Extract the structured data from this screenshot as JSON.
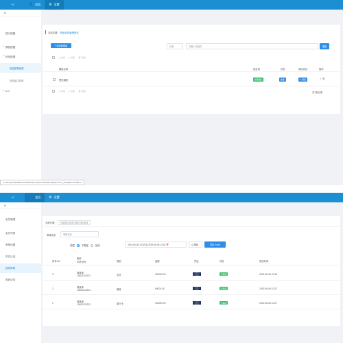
{
  "shot1": {
    "topbar": {
      "logo": "·H",
      "nav": [
        {
          "icon": "user-icon",
          "label": "会员"
        },
        {
          "icon": "gear-icon",
          "label": "设置"
        }
      ]
    },
    "sidebar": {
      "head": "Ω",
      "items": [
        {
          "label": "提示配置"
        },
        {
          "label": "模板配置"
        },
        {
          "label": "短信配置"
        },
        {
          "label": "短信配置管理",
          "sub": true,
          "active": true
        },
        {
          "label": "短信接口配置",
          "sub": true
        },
        {
          "label": "A.O",
          "partial": true
        }
      ]
    },
    "breadcrumb": {
      "label": "当前位置:",
      "link": "短信消息管理首页"
    },
    "toolbar": {
      "add_label": "+ 添加新模板",
      "search_select": "状态",
      "search_placeholder": "请输入关键词",
      "search_btn": "搜索"
    },
    "bulk": [
      "启用",
      "禁用",
      "删除"
    ],
    "table": {
      "headers": [
        "模板名称",
        "是否用",
        "状态",
        "调试测试",
        "操作"
      ],
      "rows": [
        {
          "name": "短信通知",
          "use_tag": "启用短信",
          "status_tag": "启用",
          "action": "✎ 测试"
        }
      ]
    },
    "footer": {
      "total": "共1条记录"
    },
    "url": "u.m114.yunyan008.com/web/index.php?c=site&a=entry&m=xxx_shop&do=web&r=s"
  },
  "shot2": {
    "topbar": {
      "logo": "·H",
      "nav": [
        {
          "icon": "user-icon",
          "label": "会员"
        },
        {
          "icon": "gear-icon",
          "label": "设置"
        }
      ]
    },
    "sidebar": {
      "head": "Ω",
      "items": [
        {
          "label": "会员管理"
        },
        {
          "label": "会员列表"
        },
        {
          "label": "审核设置"
        },
        {
          "label": "实名认证"
        },
        {
          "label": "提现审核",
          "active": true
        },
        {
          "label": "收款记录"
        }
      ]
    },
    "breadcrumb": {
      "label": "当前位置:",
      "link": "付款提示说明/付款/付款/审核"
    },
    "filter": {
      "status_label": "审核状态",
      "status_placeholder": "审核状态",
      "scope_label": "范围",
      "radios": [
        "不限量",
        "指定"
      ],
      "date_range": "2019-06-06 13:32 至 2019-06-06 13:32 📅",
      "search_btn": "Q 搜索",
      "export_btn": "导出 Excel"
    },
    "table": {
      "headers": [
        "序号123",
        "昵称\n手机号码",
        "类型",
        "金额",
        "凭证",
        "状态",
        "提交时间"
      ],
      "rows": [
        {
          "id": "3",
          "nick": "徐食荐",
          "phone": "13622222222",
          "type": "支贷",
          "amount": "200000.00",
          "status": "已审核",
          "time": "2019-06-06 10:28"
        },
        {
          "id": "2",
          "nick": "徐食荐",
          "phone": "13622222222",
          "type": "微信",
          "amount": "60000.00",
          "status": "已审核",
          "time": "2019-06-06 10:27"
        },
        {
          "id": "1",
          "nick": "徐食荐",
          "phone": "13622222222",
          "type": "银行卡",
          "amount": "100000.00",
          "status": "已审核",
          "time": "2019-06-06 10:27"
        }
      ]
    }
  }
}
